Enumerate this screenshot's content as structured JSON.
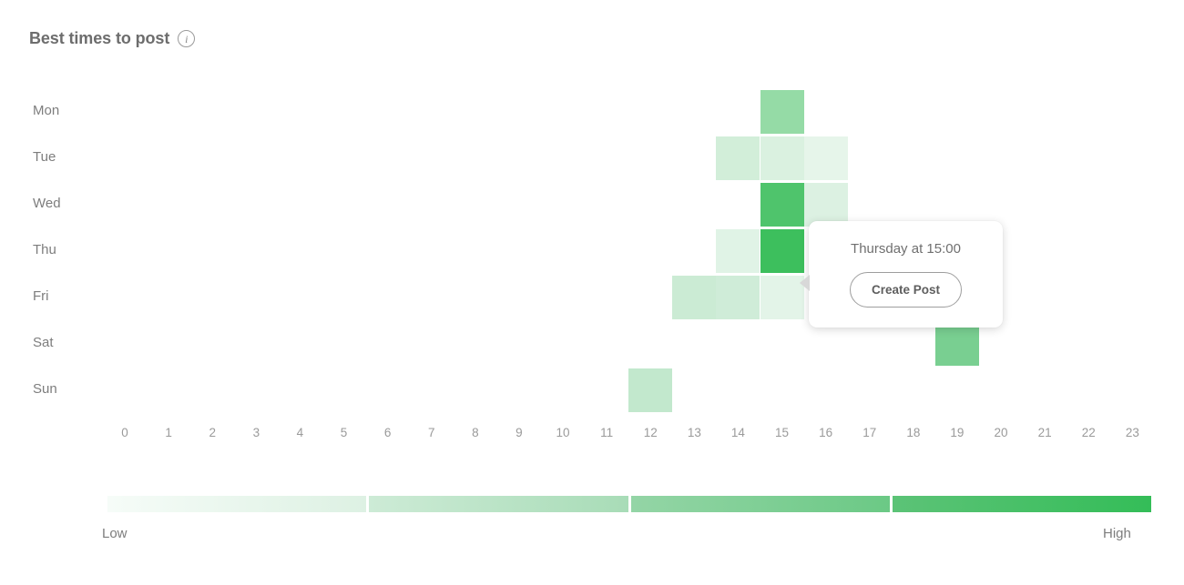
{
  "header": {
    "title": "Best times to post",
    "info_icon": "info-icon"
  },
  "chart_data": {
    "type": "heatmap",
    "title": "Best times to post",
    "xlabel": "",
    "ylabel": "",
    "rows": [
      "Mon",
      "Tue",
      "Wed",
      "Thu",
      "Fri",
      "Sat",
      "Sun"
    ],
    "columns": [
      "0",
      "1",
      "2",
      "3",
      "4",
      "5",
      "6",
      "7",
      "8",
      "9",
      "10",
      "11",
      "12",
      "13",
      "14",
      "15",
      "16",
      "17",
      "18",
      "19",
      "20",
      "21",
      "22",
      "23"
    ],
    "xlim": [
      0,
      23
    ],
    "grid": false,
    "legend": {
      "position": "bottom",
      "low_label": "Low",
      "high_label": "High",
      "segments": [
        {
          "from": "#f6fcf8",
          "to": "#ddf1e3"
        },
        {
          "from": "#cdebd6",
          "to": "#a8dcb7"
        },
        {
          "from": "#94d5a6",
          "to": "#6bc985"
        },
        {
          "from": "#5cc377",
          "to": "#34bd58"
        }
      ]
    },
    "cells": [
      {
        "day": "Mon",
        "hour": 15,
        "value": 0.52,
        "color": "#95dba6"
      },
      {
        "day": "Tue",
        "hour": 14,
        "value": 0.22,
        "color": "#d2eed9"
      },
      {
        "day": "Tue",
        "hour": 15,
        "value": 0.18,
        "color": "#daf1e0"
      },
      {
        "day": "Tue",
        "hour": 16,
        "value": 0.1,
        "color": "#e6f5ea"
      },
      {
        "day": "Wed",
        "hour": 15,
        "value": 0.86,
        "color": "#4fc46c"
      },
      {
        "day": "Wed",
        "hour": 16,
        "value": 0.17,
        "color": "#dcf1e2"
      },
      {
        "day": "Thu",
        "hour": 14,
        "value": 0.14,
        "color": "#e0f3e6"
      },
      {
        "day": "Thu",
        "hour": 15,
        "value": 1.0,
        "color": "#3dbf5d"
      },
      {
        "day": "Fri",
        "hour": 13,
        "value": 0.26,
        "color": "#cbebd4"
      },
      {
        "day": "Fri",
        "hour": 14,
        "value": 0.24,
        "color": "#cfecd8"
      },
      {
        "day": "Fri",
        "hour": 15,
        "value": 0.12,
        "color": "#e3f4e8"
      },
      {
        "day": "Sat",
        "hour": 19,
        "value": 0.55,
        "color": "#79cf91"
      },
      {
        "day": "Sun",
        "hour": 12,
        "value": 0.33,
        "color": "#c2e8cd"
      }
    ]
  },
  "tooltip": {
    "label": "Thursday at 15:00",
    "button_label": "Create Post"
  }
}
